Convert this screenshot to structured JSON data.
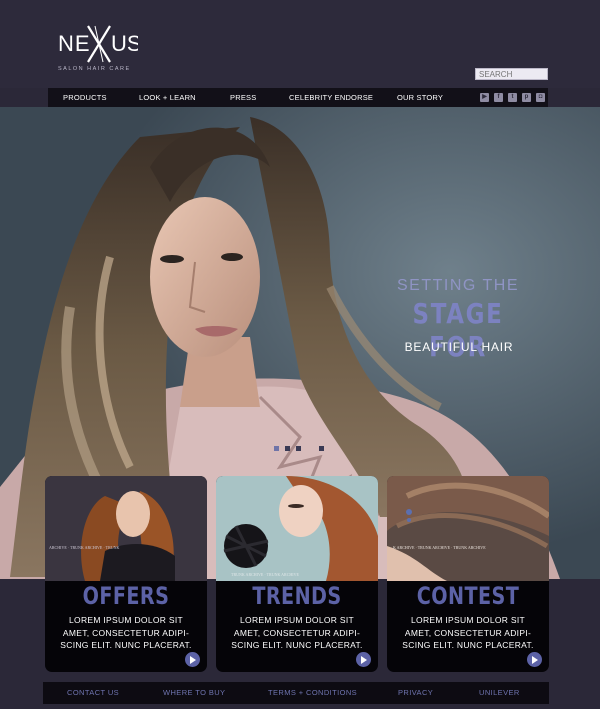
{
  "brand": {
    "name": "NEXXUS",
    "tagline": "SALON HAIR CARE"
  },
  "search": {
    "placeholder": "SEARCH"
  },
  "nav": {
    "items": [
      "PRODUCTS",
      "LOOK + LEARN",
      "PRESS",
      "CELEBRITY ENDORSE",
      "OUR STORY"
    ],
    "social_icons": [
      "youtube-icon",
      "facebook-icon",
      "twitter-icon",
      "pinterest-icon",
      "instagram-icon"
    ]
  },
  "hero": {
    "line1": "SETTING THE",
    "line2": "STAGE FOR",
    "line3": "BEAUTIFUL HAIR",
    "slide_count": 4,
    "active_slide": 1
  },
  "cards": [
    {
      "title": "OFFERS",
      "body": "LOREM IPSUM DOLOR SIT AMET, CONSECTETUR ADIPI-SCING ELIT. NUNC PLACERAT."
    },
    {
      "title": "TRENDS",
      "body": "LOREM IPSUM DOLOR SIT AMET, CONSECTETUR ADIPI-SCING ELIT. NUNC PLACERAT."
    },
    {
      "title": "CONTEST",
      "body": "LOREM IPSUM DOLOR SIT AMET, CONSECTETUR ADIPI-SCING ELIT. NUNC PLACERAT."
    }
  ],
  "footer": {
    "items": [
      "CONTACT US",
      "WHERE TO BUY",
      "TERMS + CONDITIONS",
      "PRIVACY",
      "UNILEVER"
    ]
  },
  "colors": {
    "background": "#2b2838",
    "nav_bar": "#121018",
    "accent": "#5c62a6",
    "hero_text": "#7c82c0"
  }
}
